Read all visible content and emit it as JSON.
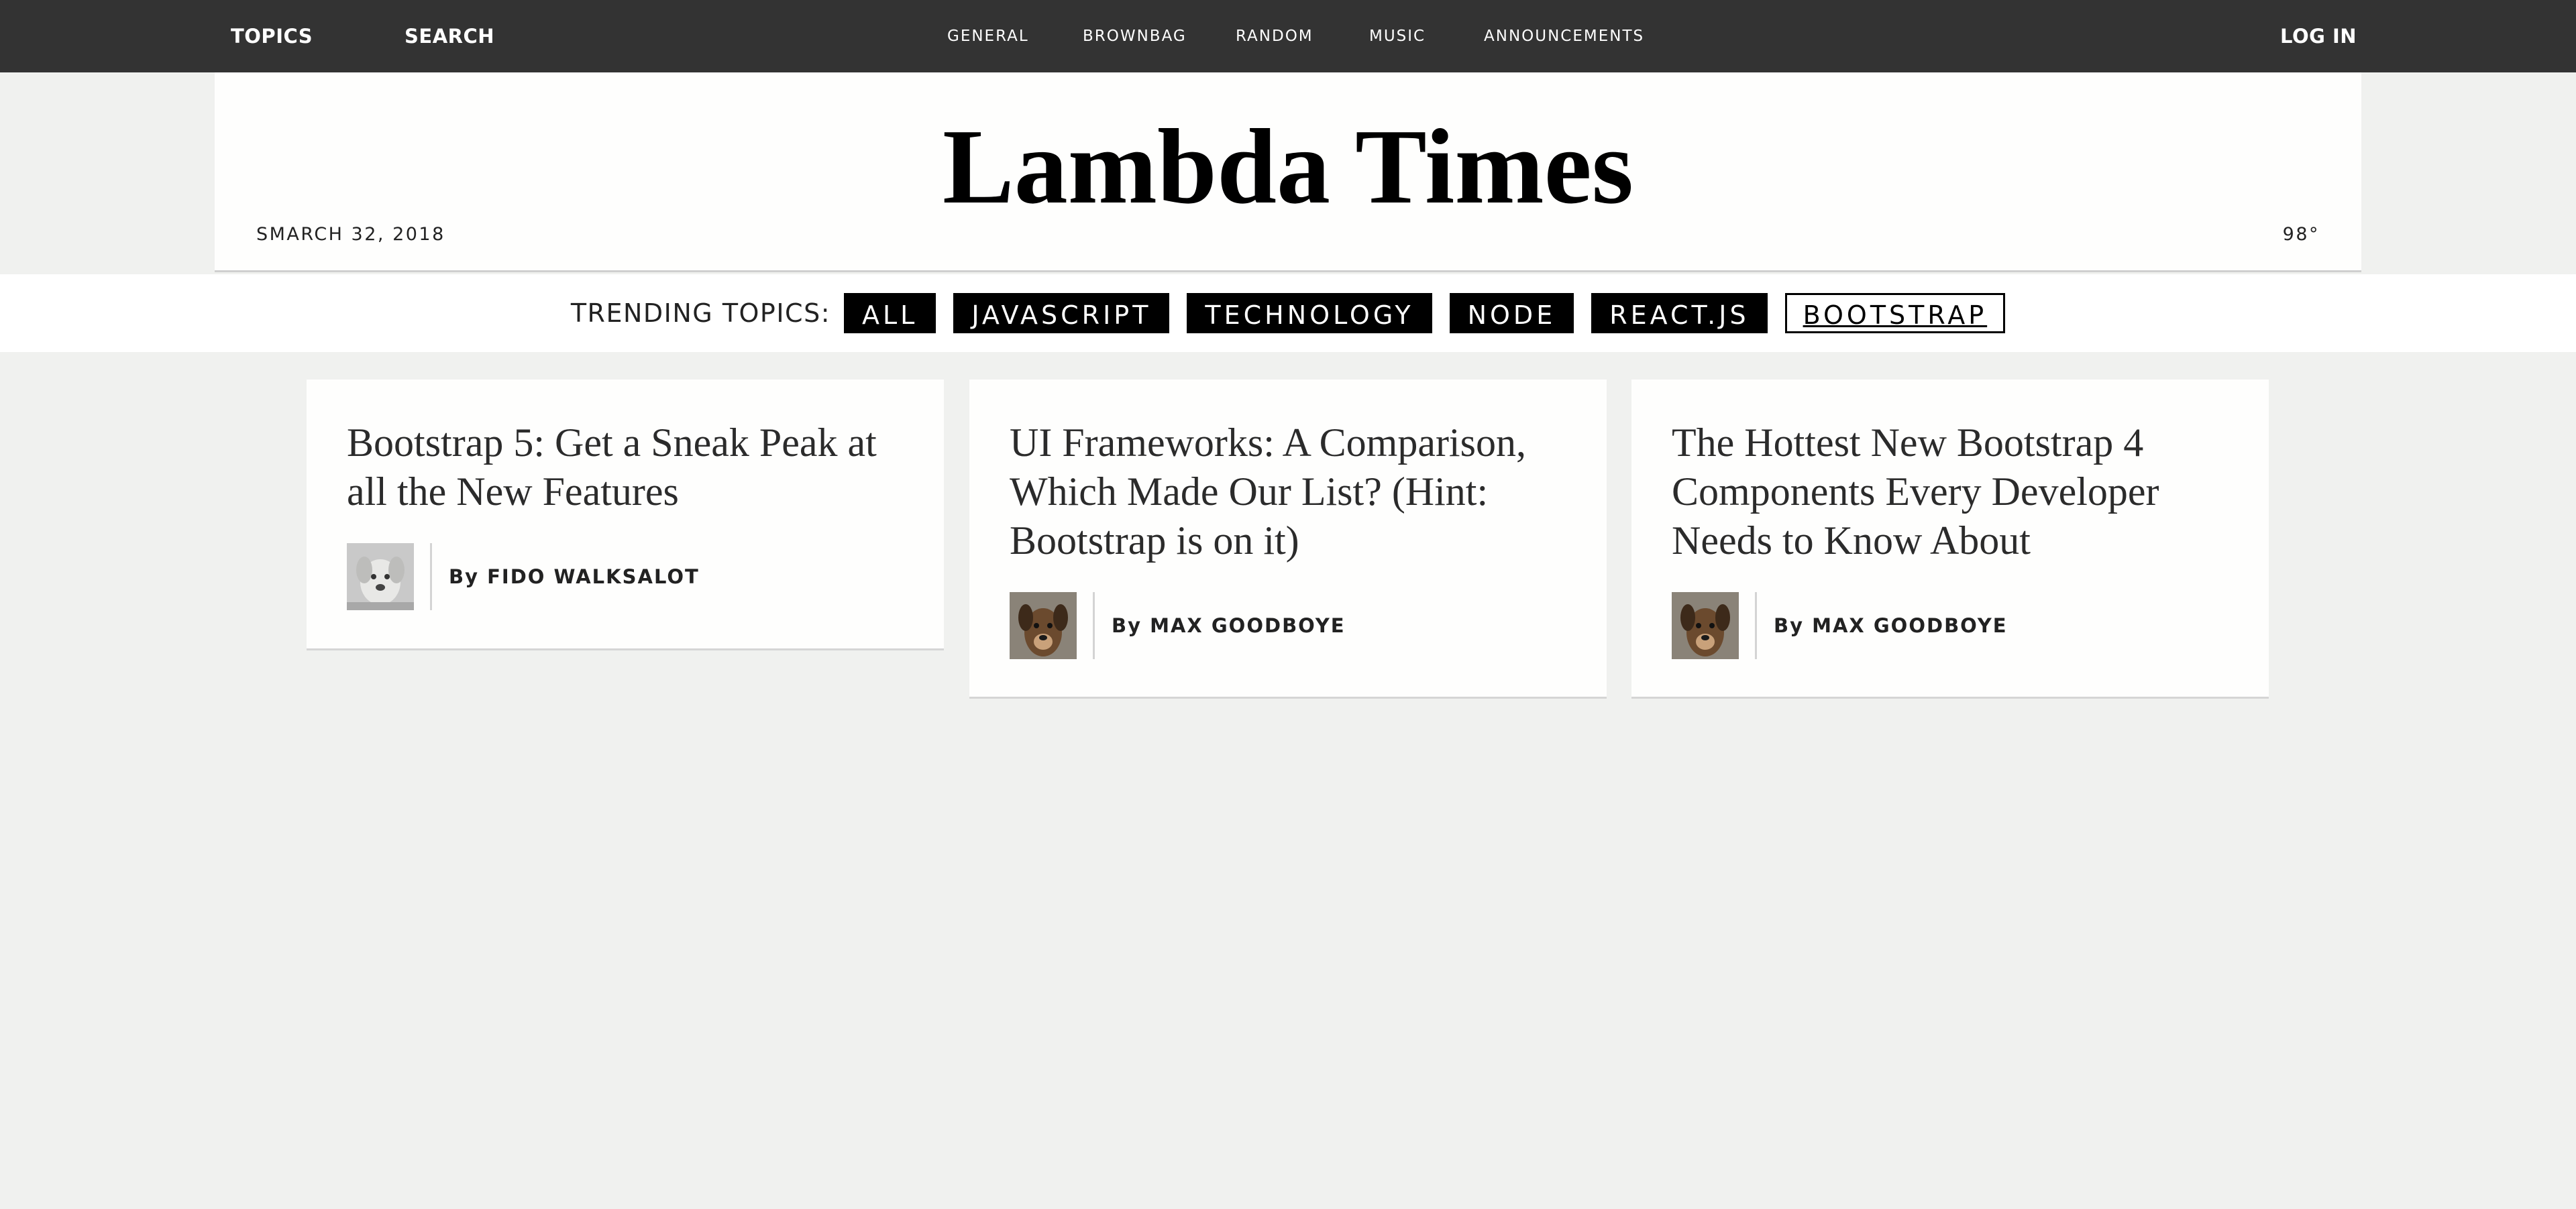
{
  "topbar": {
    "left_links": [
      "TOPICS",
      "SEARCH"
    ],
    "center_links": [
      "GENERAL",
      "BROWNBAG",
      "RANDOM",
      "MUSIC",
      "ANNOUNCEMENTS"
    ],
    "login": "LOG IN"
  },
  "header": {
    "title": "Lambda Times",
    "date": "SMARCH 32, 2018",
    "temperature": "98°"
  },
  "topics": {
    "label": "TRENDING TOPICS:",
    "tags": [
      "ALL",
      "JAVASCRIPT",
      "TECHNOLOGY",
      "NODE",
      "REACT.JS",
      "BOOTSTRAP"
    ],
    "selected": "BOOTSTRAP"
  },
  "cards": [
    {
      "headline": "Bootstrap 5: Get a Sneak Peak at all the New Features",
      "by": "By",
      "author": "FIDO WALKSALOT"
    },
    {
      "headline": "UI Frameworks: A Comparison, Which Made Our List? (Hint: Bootstrap is on it)",
      "by": "By",
      "author": "MAX GOODBOYE"
    },
    {
      "headline": "The Hottest New Bootstrap 4 Components Every Developer Needs to Know About",
      "by": "By",
      "author": "MAX GOODBOYE"
    }
  ],
  "colors": {
    "topbar_bg": "#333333",
    "page_bg": "#f0f1ef",
    "tag_bg": "#000000",
    "card_bg": "#fefefd"
  }
}
